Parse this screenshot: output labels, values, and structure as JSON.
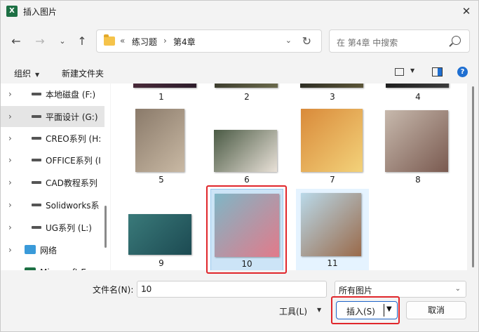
{
  "window": {
    "title": "插入图片",
    "app_icon_letter": "X"
  },
  "nav": {
    "address": {
      "ellipsis": "«",
      "crumbs": [
        "练习题",
        "第4章"
      ]
    },
    "search_placeholder": "在 第4章 中搜索"
  },
  "toolbar": {
    "organize_label": "组织",
    "new_folder_label": "新建文件夹"
  },
  "sidebar": {
    "items": [
      {
        "label": "本地磁盘 (F:)",
        "icon": "drive-icon"
      },
      {
        "label": "平面设计 (G:)",
        "icon": "drive-icon",
        "selected": true
      },
      {
        "label": "CREO系列 (H:",
        "icon": "drive-icon"
      },
      {
        "label": "OFFICE系列 (I",
        "icon": "drive-icon"
      },
      {
        "label": "CAD教程系列",
        "icon": "drive-icon"
      },
      {
        "label": "Solidworks系",
        "icon": "drive-icon"
      },
      {
        "label": "UG系列 (L:)",
        "icon": "drive-icon"
      },
      {
        "label": "网络",
        "icon": "network-icon"
      },
      {
        "label": "Microsoft Exc",
        "icon": "excel-icon"
      }
    ]
  },
  "files": [
    {
      "name": "1",
      "colors": [
        "#4a2a3a",
        "#2c1c2a"
      ]
    },
    {
      "name": "2",
      "colors": [
        "#3a3a2c",
        "#6b6a4c"
      ]
    },
    {
      "name": "3",
      "colors": [
        "#2a2a22",
        "#5c5638"
      ]
    },
    {
      "name": "4",
      "colors": [
        "#1c1c1c",
        "#3c3c3c"
      ]
    },
    {
      "name": "5",
      "colors": [
        "#8a7a6a",
        "#c9b9a4"
      ]
    },
    {
      "name": "6",
      "colors": [
        "#4a5a44",
        "#e9e1d8"
      ]
    },
    {
      "name": "7",
      "colors": [
        "#d98a3a",
        "#f3d27a"
      ]
    },
    {
      "name": "8",
      "colors": [
        "#c7b9ad",
        "#7a5a50"
      ]
    },
    {
      "name": "9",
      "colors": [
        "#3a7a7a",
        "#1c4a52"
      ]
    },
    {
      "name": "10",
      "colors": [
        "#7fb6c6",
        "#e27a8a"
      ],
      "selected": true
    },
    {
      "name": "11",
      "colors": [
        "#b9d9e9",
        "#9a6a4a"
      ],
      "hovered": true
    }
  ],
  "bottom": {
    "filename_label": "文件名(N):",
    "filename_value": "10",
    "filetype_value": "所有图片",
    "tools_label": "工具(L)",
    "insert_label": "插入(S)",
    "cancel_label": "取消"
  },
  "colors": {
    "accent": "#1f6fd1",
    "highlight": "#e0262b",
    "selection": "#cce4f7"
  }
}
